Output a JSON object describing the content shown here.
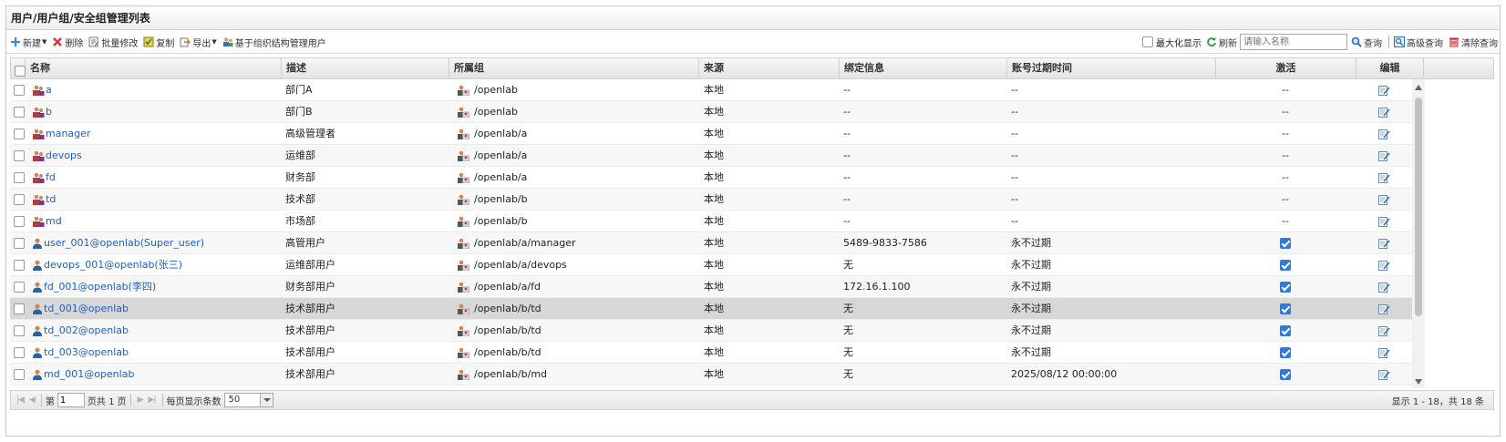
{
  "panel_title": "用户/用户组/安全组管理列表",
  "toolbar": {
    "new_label": "新建",
    "delete_label": "删除",
    "batch_edit_label": "批量修改",
    "copy_label": "复制",
    "export_label": "导出",
    "org_manage_label": "基于组织结构管理用户",
    "maximize_label": "最大化显示",
    "refresh_label": "刷新",
    "search_placeholder": "请输入名称",
    "query_label": "查询",
    "advanced_query_label": "高级查询",
    "clear_query_label": "清除查询"
  },
  "columns": {
    "name": "名称",
    "desc": "描述",
    "group": "所属组",
    "source": "来源",
    "binding": "绑定信息",
    "expiry": "账号过期时间",
    "active": "激活",
    "edit": "编辑"
  },
  "rows": [
    {
      "type": "group",
      "name": "a",
      "desc": "部门A",
      "group": "/openlab",
      "source": "本地",
      "binding": "--",
      "expiry": "--",
      "active": "--"
    },
    {
      "type": "group",
      "name": "b",
      "desc": "部门B",
      "group": "/openlab",
      "source": "本地",
      "binding": "--",
      "expiry": "--",
      "active": "--"
    },
    {
      "type": "group",
      "name": "manager",
      "desc": "高级管理者",
      "group": "/openlab/a",
      "source": "本地",
      "binding": "--",
      "expiry": "--",
      "active": "--"
    },
    {
      "type": "group",
      "name": "devops",
      "desc": "运维部",
      "group": "/openlab/a",
      "source": "本地",
      "binding": "--",
      "expiry": "--",
      "active": "--"
    },
    {
      "type": "group",
      "name": "fd",
      "desc": "财务部",
      "group": "/openlab/a",
      "source": "本地",
      "binding": "--",
      "expiry": "--",
      "active": "--"
    },
    {
      "type": "group",
      "name": "td",
      "desc": "技术部",
      "group": "/openlab/b",
      "source": "本地",
      "binding": "--",
      "expiry": "--",
      "active": "--"
    },
    {
      "type": "group",
      "name": "md",
      "desc": "市场部",
      "group": "/openlab/b",
      "source": "本地",
      "binding": "--",
      "expiry": "--",
      "active": "--"
    },
    {
      "type": "user",
      "name": "user_001@openlab(Super_user)",
      "desc": "高管用户",
      "group": "/openlab/a/manager",
      "source": "本地",
      "binding": "5489-9833-7586",
      "expiry": "永不过期",
      "active": true
    },
    {
      "type": "user",
      "name": "devops_001@openlab(张三)",
      "desc": "运维部用户",
      "group": "/openlab/a/devops",
      "source": "本地",
      "binding": "无",
      "expiry": "永不过期",
      "active": true
    },
    {
      "type": "user",
      "name": "fd_001@openlab(李四)",
      "desc": "财务部用户",
      "group": "/openlab/a/fd",
      "source": "本地",
      "binding": "172.16.1.100",
      "expiry": "永不过期",
      "active": true
    },
    {
      "type": "user",
      "name": "td_001@openlab",
      "desc": "技术部用户",
      "group": "/openlab/b/td",
      "source": "本地",
      "binding": "无",
      "expiry": "永不过期",
      "active": true,
      "selected": true
    },
    {
      "type": "user",
      "name": "td_002@openlab",
      "desc": "技术部用户",
      "group": "/openlab/b/td",
      "source": "本地",
      "binding": "无",
      "expiry": "永不过期",
      "active": true
    },
    {
      "type": "user",
      "name": "td_003@openlab",
      "desc": "技术部用户",
      "group": "/openlab/b/td",
      "source": "本地",
      "binding": "无",
      "expiry": "永不过期",
      "active": true
    },
    {
      "type": "user",
      "name": "md_001@openlab",
      "desc": "技术部用户",
      "group": "/openlab/b/md",
      "source": "本地",
      "binding": "无",
      "expiry": "2025/08/12 00:00:00",
      "active": true
    }
  ],
  "pager": {
    "page_prefix": "第",
    "page_value": "1",
    "page_suffix": "页共 1 页",
    "per_page_label": "每页显示条数",
    "per_page_value": "50",
    "summary": "显示 1 - 18，共 18 条"
  },
  "colors": {
    "link": "#1f5fc4",
    "checkbox_checked": "#2e7bd9",
    "selected_row": "#d7d7d7"
  }
}
